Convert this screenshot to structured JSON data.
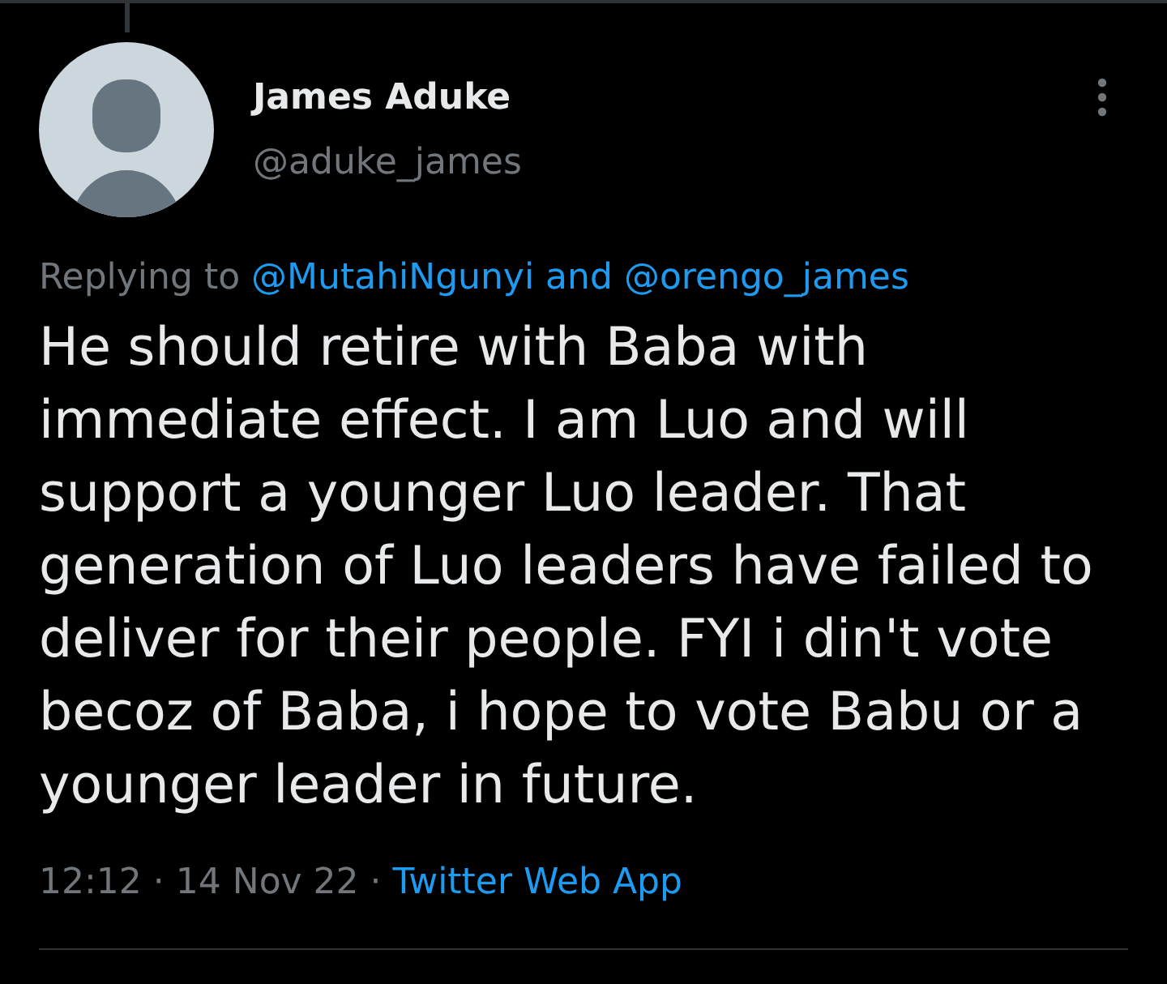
{
  "tweet": {
    "author": {
      "name": "James Aduke",
      "handle": "@aduke_james"
    },
    "reply_context": {
      "prefix": "Replying to",
      "mentions": [
        "@MutahiNgunyi",
        "@orengo_james"
      ],
      "joiner": "and"
    },
    "text": "He should retire with Baba with immediate effect. I am Luo and will support a younger Luo leader. That generation of Luo leaders have failed to deliver for their people. FYI i din't vote becoz of Baba, i hope to vote Babu or a younger leader in future.",
    "meta": {
      "time": "12:12",
      "separator": "·",
      "date": "14 Nov 22",
      "source": "Twitter Web App"
    }
  }
}
